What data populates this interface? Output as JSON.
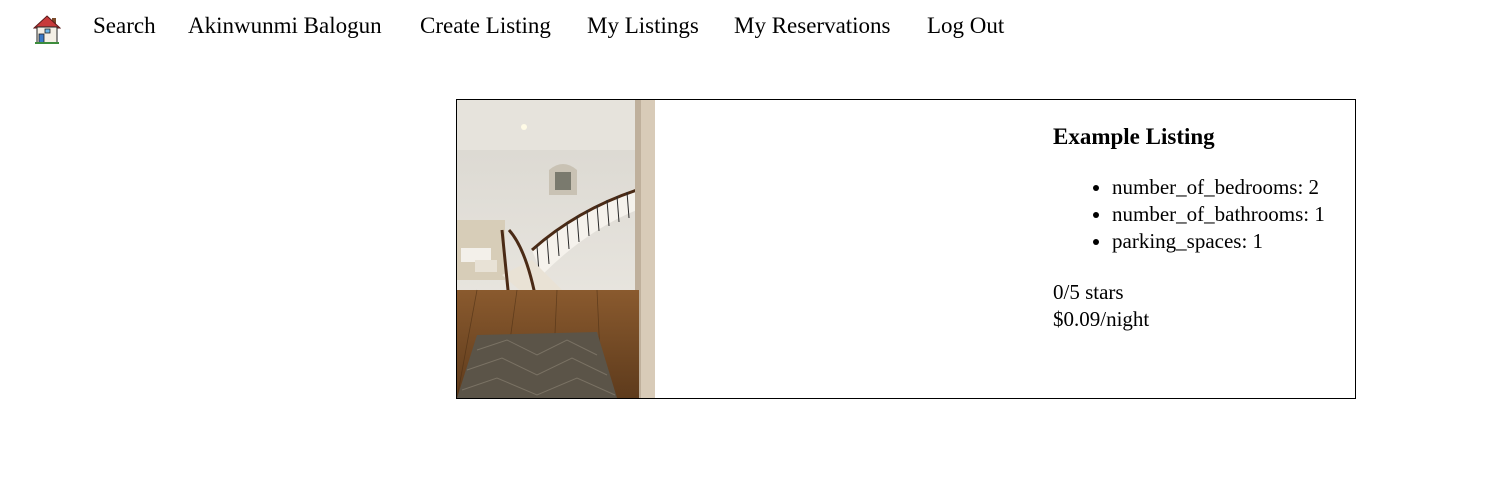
{
  "nav": {
    "home_icon": "house-icon",
    "links": [
      {
        "label": "Search"
      },
      {
        "label": "Akinwunmi Balogun"
      },
      {
        "label": "Create Listing"
      },
      {
        "label": "My Listings"
      },
      {
        "label": "My Reservations"
      },
      {
        "label": "Log Out"
      }
    ]
  },
  "listing": {
    "image_icon": "staircase-interior-photo",
    "title": "Example Listing",
    "features": [
      "number_of_bedrooms: 2",
      "number_of_bathrooms: 1",
      "parking_spaces: 1"
    ],
    "rating": "0/5 stars",
    "price": "$0.09/night"
  }
}
